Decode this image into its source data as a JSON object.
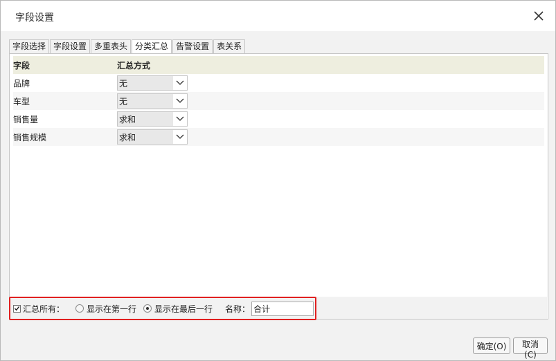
{
  "dialog": {
    "title": "字段设置",
    "close_icon": "close-icon"
  },
  "tabs": [
    {
      "label": "字段选择",
      "active": false
    },
    {
      "label": "字段设置",
      "active": false
    },
    {
      "label": "多重表头",
      "active": false
    },
    {
      "label": "分类汇总",
      "active": true
    },
    {
      "label": "告警设置",
      "active": false
    },
    {
      "label": "表关系",
      "active": false
    }
  ],
  "grid": {
    "headers": {
      "field": "字段",
      "method": "汇总方式"
    },
    "rows": [
      {
        "field": "品牌",
        "method": "无"
      },
      {
        "field": "车型",
        "method": "无"
      },
      {
        "field": "销售量",
        "method": "求和"
      },
      {
        "field": "销售规模",
        "method": "求和"
      }
    ],
    "header_bg": "#eeeedf"
  },
  "summary": {
    "checkbox_label": "汇总所有：",
    "checked": true,
    "radio_first": "显示在第一行",
    "radio_last": "显示在最后一行",
    "selected": "last",
    "name_label": "名称：",
    "name_value": "合计",
    "highlight_color": "#e02020"
  },
  "buttons": {
    "ok": "确定(O)",
    "cancel": "取消(C)"
  }
}
